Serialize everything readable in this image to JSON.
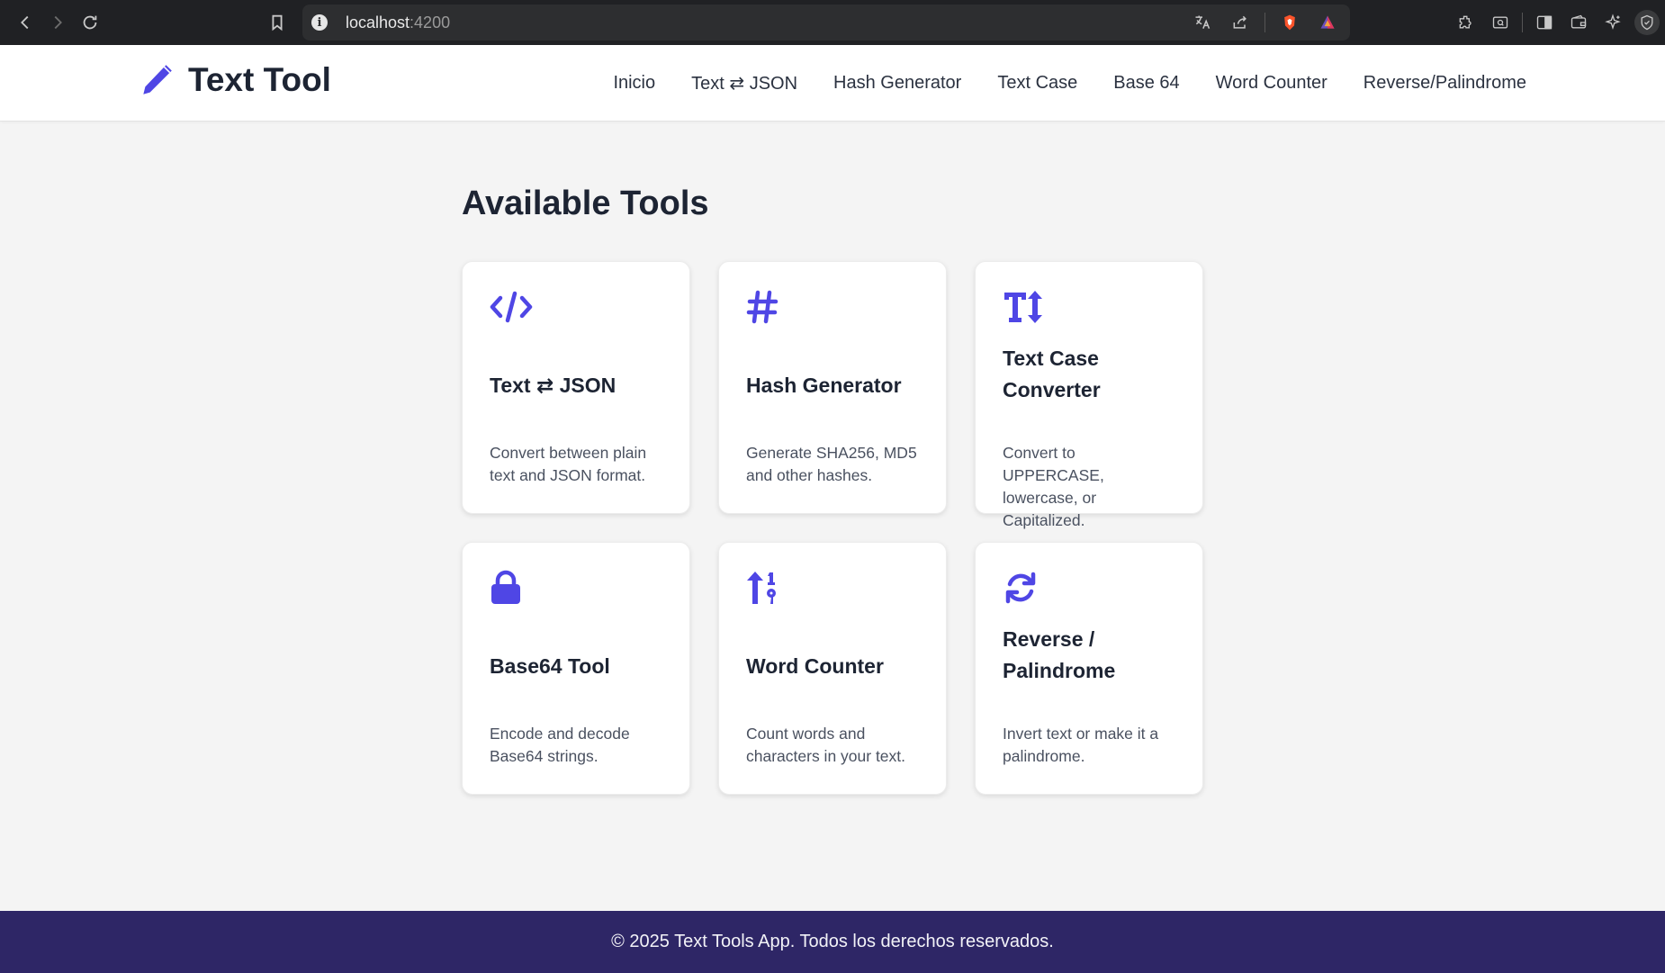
{
  "browser": {
    "url_host": "localhost",
    "url_port": ":4200"
  },
  "header": {
    "brand": "Text Tool",
    "nav": [
      "Inicio",
      "Text ⇄ JSON",
      "Hash Generator",
      "Text Case",
      "Base 64",
      "Word Counter",
      "Reverse/Palindrome"
    ]
  },
  "main": {
    "title": "Available Tools",
    "cards": [
      {
        "icon": "code-icon",
        "title": "Text ⇄ JSON",
        "description": "Convert between plain text and JSON format."
      },
      {
        "icon": "hash-icon",
        "title": "Hash Generator",
        "description": "Generate SHA256, MD5 and other hashes."
      },
      {
        "icon": "text-height-icon",
        "title": "Text Case Converter",
        "description": "Convert to UPPERCASE, lowercase, or Capitalized."
      },
      {
        "icon": "lock-icon",
        "title": "Base64 Tool",
        "description": "Encode and decode Base64 strings."
      },
      {
        "icon": "sort-numeric-icon",
        "title": "Word Counter",
        "description": "Count words and characters in your text."
      },
      {
        "icon": "sync-icon",
        "title": "Reverse / Palindrome",
        "description": "Invert text or make it a palindrome."
      }
    ]
  },
  "footer": {
    "text": "© 2025 Text Tools App. Todos los derechos reservados."
  },
  "colors": {
    "accent": "#4f46e5",
    "footer_bg": "#2e2666",
    "page_bg": "#f4f4f4"
  }
}
